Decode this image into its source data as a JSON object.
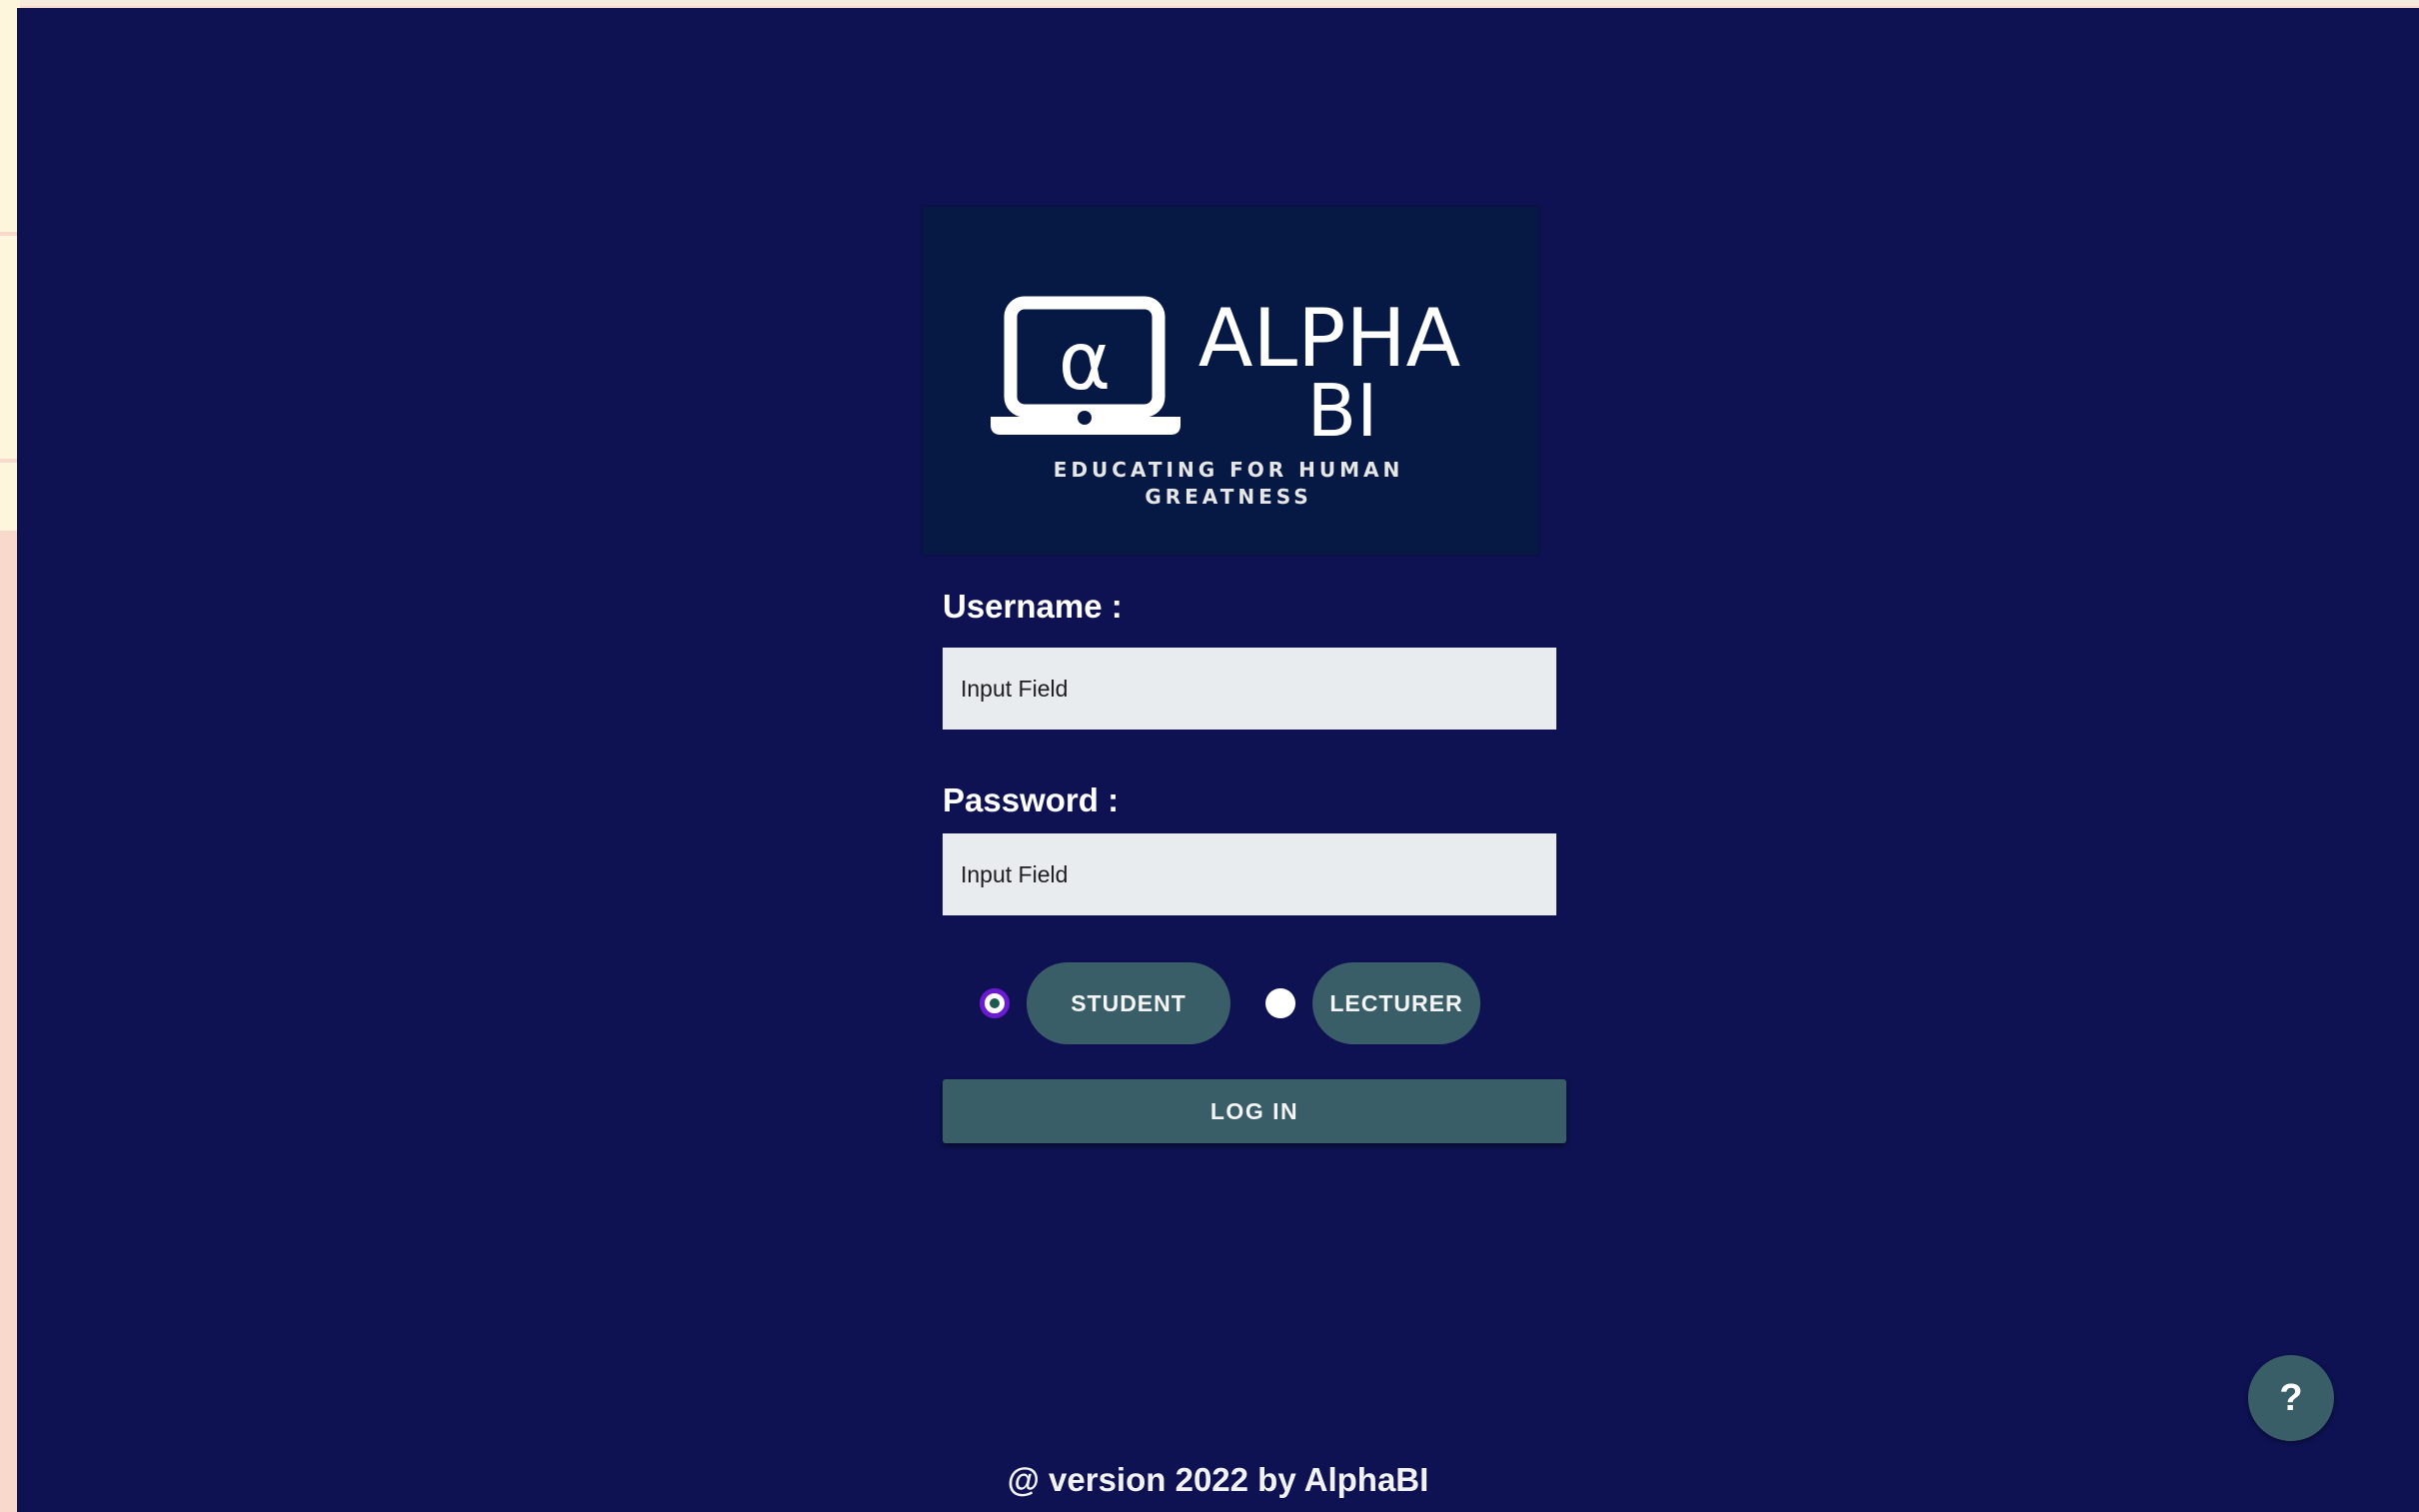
{
  "colors": {
    "app_background": "#0e1252",
    "logo_background": "#061944",
    "input_background": "#e8ecef",
    "button_color": "#3a5e67",
    "radio_selected_border": "#6a1bd1"
  },
  "logo": {
    "icon": "laptop-alpha-icon",
    "symbol": "α",
    "title_line1": "ALPHA",
    "title_line2": "BI",
    "tagline_line1": "EDUCATING FOR HUMAN",
    "tagline_line2": "GREATNESS"
  },
  "form": {
    "username": {
      "label": "Username :",
      "placeholder": "Input Field"
    },
    "password": {
      "label": "Password :",
      "placeholder": "Input Field"
    },
    "roles": [
      {
        "label": "STUDENT",
        "selected": true
      },
      {
        "label": "LECTURER",
        "selected": false
      }
    ],
    "login_label": "LOG IN"
  },
  "help": {
    "label": "?",
    "icon": "question-icon"
  },
  "footer": {
    "text": "@ version 2022 by AlphaBI"
  }
}
